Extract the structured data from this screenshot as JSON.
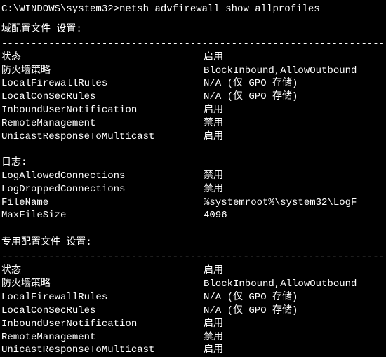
{
  "prompt": {
    "path": "C:\\WINDOWS\\system32>",
    "command": "netsh advfirewall show allprofiles"
  },
  "divider": "----------------------------------------------------------------------",
  "sections": [
    {
      "title": "域配置文件 设置:",
      "groups": [
        [
          {
            "key": "状态",
            "val": "启用"
          },
          {
            "key": "防火墙策略",
            "val": "BlockInbound,AllowOutbound"
          },
          {
            "key": "LocalFirewallRules",
            "val": "N/A (仅 GPO 存储)"
          },
          {
            "key": "LocalConSecRules",
            "val": "N/A (仅 GPO 存储)"
          },
          {
            "key": "InboundUserNotification",
            "val": "启用"
          },
          {
            "key": "RemoteManagement",
            "val": "禁用"
          },
          {
            "key": "UnicastResponseToMulticast",
            "val": "启用"
          }
        ],
        [
          {
            "key": "日志:",
            "val": ""
          },
          {
            "key": "LogAllowedConnections",
            "val": "禁用"
          },
          {
            "key": "LogDroppedConnections",
            "val": "禁用"
          },
          {
            "key": "FileName",
            "val": "%systemroot%\\system32\\LogF"
          },
          {
            "key": "MaxFileSize",
            "val": "4096"
          }
        ]
      ]
    },
    {
      "title": "专用配置文件 设置:",
      "groups": [
        [
          {
            "key": "状态",
            "val": "启用"
          },
          {
            "key": "防火墙策略",
            "val": "BlockInbound,AllowOutbound"
          },
          {
            "key": "LocalFirewallRules",
            "val": "N/A (仅 GPO 存储)"
          },
          {
            "key": "LocalConSecRules",
            "val": "N/A (仅 GPO 存储)"
          },
          {
            "key": "InboundUserNotification",
            "val": "启用"
          },
          {
            "key": "RemoteManagement",
            "val": "禁用"
          },
          {
            "key": "UnicastResponseToMulticast",
            "val": "启用"
          }
        ]
      ]
    }
  ]
}
